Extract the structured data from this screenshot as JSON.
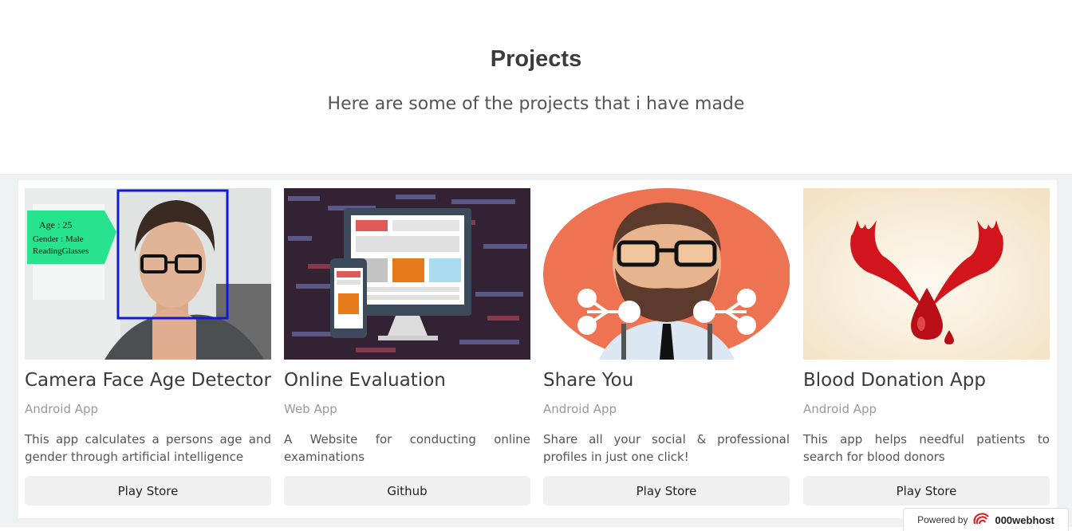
{
  "header": {
    "title": "Projects",
    "subtitle": "Here are some of the projects that i have made"
  },
  "projects": [
    {
      "title": "Camera Face Age Detector",
      "category": "Android App",
      "description": "This app calculates a persons age and gender through artificial intelligence",
      "button": "Play Store",
      "image_overlay": [
        "Age : 25",
        "Gender : Male",
        "ReadingGlasses"
      ]
    },
    {
      "title": "Online Evaluation",
      "category": "Web App",
      "description": "A Website for conducting online examinations",
      "button": "Github"
    },
    {
      "title": "Share You",
      "category": "Android App",
      "description": "Share all your social & professional profiles in just one click!",
      "button": "Play Store"
    },
    {
      "title": "Blood Donation App",
      "category": "Android App",
      "description": "This app helps needful patients to search for blood donors",
      "button": "Play Store"
    }
  ],
  "footer_badge": {
    "prefix": "Powered by",
    "brand": "000webhost"
  },
  "colors": {
    "band_bg": "#eef2f2",
    "button_bg": "#f0f0f0",
    "accent_red": "#d3272a"
  }
}
